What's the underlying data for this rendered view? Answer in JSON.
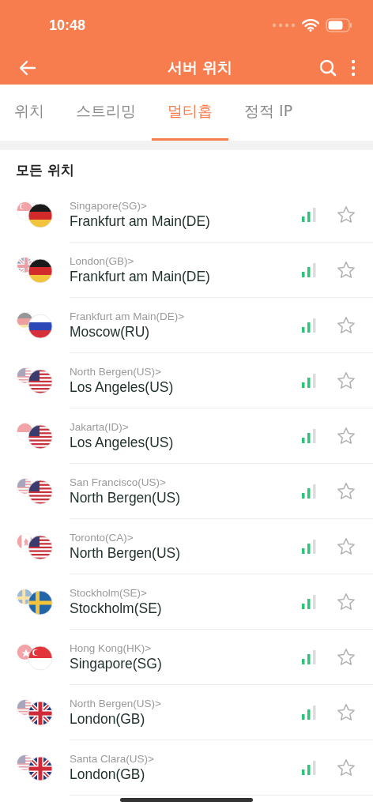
{
  "status_bar": {
    "time": "10:48"
  },
  "header": {
    "title": "서버 위치"
  },
  "tabs": [
    {
      "label": "위치",
      "selected": false
    },
    {
      "label": "스트리밍",
      "selected": false
    },
    {
      "label": "멀티홉",
      "selected": true
    },
    {
      "label": "정적 IP",
      "selected": false
    }
  ],
  "section_title": "모든 위치",
  "servers": [
    {
      "from": "Singapore(SG)>",
      "to": "Frankfurt am Main(DE)",
      "from_flag": {
        "kind": "sg"
      },
      "to_flag": {
        "kind": "de"
      },
      "favorite": false
    },
    {
      "from": "London(GB)>",
      "to": "Frankfurt am Main(DE)",
      "from_flag": {
        "kind": "gb"
      },
      "to_flag": {
        "kind": "de"
      },
      "favorite": false
    },
    {
      "from": "Frankfurt am Main(DE)>",
      "to": "Moscow(RU)",
      "from_flag": {
        "kind": "de"
      },
      "to_flag": {
        "kind": "ru"
      },
      "favorite": false
    },
    {
      "from": "North Bergen(US)>",
      "to": "Los Angeles(US)",
      "from_flag": {
        "kind": "us"
      },
      "to_flag": {
        "kind": "us"
      },
      "favorite": false
    },
    {
      "from": "Jakarta(ID)>",
      "to": "Los Angeles(US)",
      "from_flag": {
        "kind": "id"
      },
      "to_flag": {
        "kind": "us"
      },
      "favorite": false
    },
    {
      "from": "San Francisco(US)>",
      "to": "North Bergen(US)",
      "from_flag": {
        "kind": "us"
      },
      "to_flag": {
        "kind": "us"
      },
      "favorite": false
    },
    {
      "from": "Toronto(CA)>",
      "to": "North Bergen(US)",
      "from_flag": {
        "kind": "ca"
      },
      "to_flag": {
        "kind": "us"
      },
      "favorite": false
    },
    {
      "from": "Stockholm(SE)>",
      "to": "Stockholm(SE)",
      "from_flag": {
        "kind": "se"
      },
      "to_flag": {
        "kind": "se"
      },
      "favorite": false
    },
    {
      "from": "Hong Kong(HK)>",
      "to": "Singapore(SG)",
      "from_flag": {
        "kind": "hk"
      },
      "to_flag": {
        "kind": "sg"
      },
      "favorite": false
    },
    {
      "from": "North Bergen(US)>",
      "to": "London(GB)",
      "from_flag": {
        "kind": "us"
      },
      "to_flag": {
        "kind": "gb"
      },
      "favorite": false
    },
    {
      "from": "Santa Clara(US)>",
      "to": "London(GB)",
      "from_flag": {
        "kind": "us"
      },
      "to_flag": {
        "kind": "gb"
      },
      "favorite": false
    }
  ]
}
